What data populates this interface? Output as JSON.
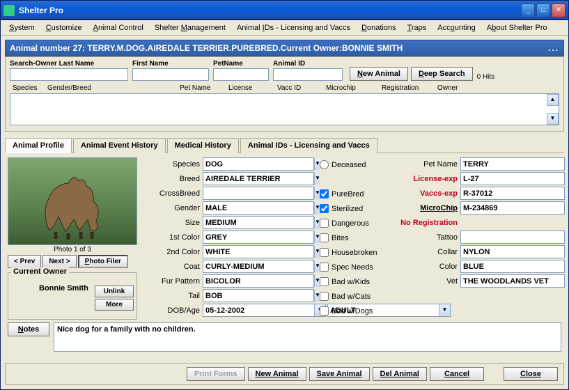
{
  "window": {
    "title": "Shelter Pro"
  },
  "menu": {
    "system": "System",
    "customize": "Customize",
    "animal_control": "Animal Control",
    "shelter_mgmt": "Shelter Management",
    "animal_ids": "Animal IDs - Licensing and Vaccs",
    "donations": "Donations",
    "traps": "Traps",
    "accounting": "Accounting",
    "about": "About Shelter Pro"
  },
  "header": {
    "text": "Animal number 27: TERRY.M.DOG.AIREDALE TERRIER.PUREBRED.Current Owner:BONNIE SMITH"
  },
  "search": {
    "labels": {
      "owner_last": "Search-Owner Last Name",
      "first": "First Name",
      "pet": "PetName",
      "animal_id": "Animal ID"
    },
    "new_animal": "New Animal",
    "deep_search": "Deep Search",
    "hits": "0 Hits",
    "cols": {
      "species": "Species",
      "gender_breed": "Gender/Breed",
      "pet": "Pet Name",
      "license": "License",
      "vacc": "Vacc ID",
      "microchip": "Microchip",
      "registration": "Registration",
      "owner": "Owner"
    }
  },
  "tabs": {
    "profile": "Animal Profile",
    "history": "Animal Event History",
    "medical": "Medical History",
    "ids": "Animal IDs - Licensing and Vaccs"
  },
  "photo": {
    "caption": "Photo 1 of 3",
    "prev": "< Prev",
    "next": "Next >",
    "filer": "Photo Filer"
  },
  "owner": {
    "group": "Current Owner",
    "name": "Bonnie Smith",
    "unlink": "Unlink",
    "more": "More"
  },
  "notes_btn": "Notes",
  "attrs": {
    "labels": {
      "species": "Species",
      "breed": "Breed",
      "crossbreed": "CrossBreed",
      "gender": "Gender",
      "size": "Size",
      "c1": "1st Color",
      "c2": "2nd Color",
      "coat": "Coat",
      "fur": "Fur Pattern",
      "tail": "Tail",
      "dob": "DOB/Age"
    },
    "values": {
      "species": "DOG",
      "breed": "AIREDALE TERRIER",
      "crossbreed": "",
      "gender": "MALE",
      "size": "MEDIUM",
      "c1": "GREY",
      "c2": "WHITE",
      "coat": "CURLY-MEDIUM",
      "fur": "BICOLOR",
      "tail": "BOB",
      "dob": "05-12-2002",
      "age": "ADULT"
    }
  },
  "flags": {
    "deceased": "Deceased",
    "purebred": "PureBred",
    "sterilized": "Sterilized",
    "dangerous": "Dangerous",
    "bites": "Bites",
    "housebroken": "Housebroken",
    "specneeds": "Spec Needs",
    "kids": "Bad w/Kids",
    "cats": "Bad w/Cats",
    "dogs": "Bad w/Dogs"
  },
  "right": {
    "labels": {
      "petname": "Pet Name",
      "license": "License-exp",
      "vaccs": "Vaccs-exp",
      "microchip": "MicroChip",
      "noreg": "No Registration",
      "tattoo": "Tattoo",
      "collar": "Collar",
      "color": "Color",
      "vet": "Vet"
    },
    "values": {
      "petname": "TERRY",
      "license": "L-27",
      "vaccs": "R-37012",
      "microchip": "M-234869",
      "tattoo": "",
      "collar": "NYLON",
      "color": "BLUE",
      "vet": "THE WOODLANDS VET"
    }
  },
  "notes": {
    "text": "Nice dog for a family with no children."
  },
  "buttons": {
    "print": "Print Forms",
    "new": "New Animal",
    "save": "Save Animal",
    "del": "Del Animal",
    "cancel": "Cancel",
    "close": "Close"
  }
}
